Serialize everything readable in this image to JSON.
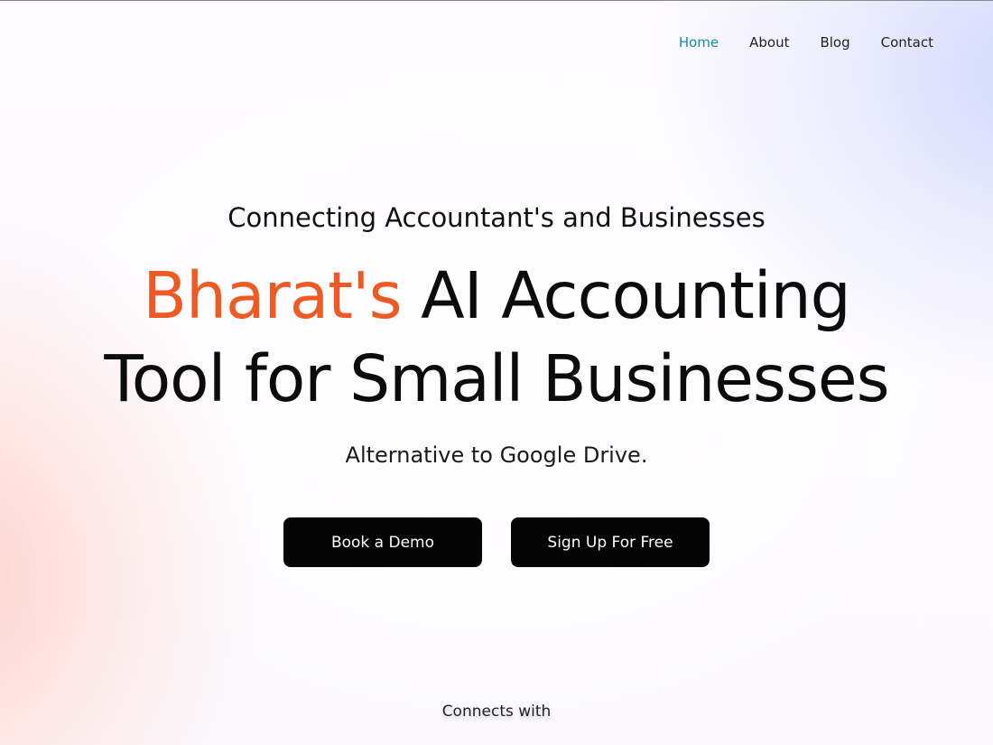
{
  "nav": {
    "items": [
      {
        "label": "Home",
        "active": true
      },
      {
        "label": "About",
        "active": false
      },
      {
        "label": "Blog",
        "active": false
      },
      {
        "label": "Contact",
        "active": false
      }
    ]
  },
  "hero": {
    "eyebrow": "Connecting Accountant's and Businesses",
    "headline_accent": "Bharat's",
    "headline_line1_rest": "AI Accounting",
    "headline_line2": "Tool for Small Businesses",
    "subtitle": "Alternative to Google Drive."
  },
  "cta": {
    "demo_label": "Book a Demo",
    "signup_label": "Sign Up For Free"
  },
  "integrations": {
    "heading": "Connects with"
  },
  "colors": {
    "accent": "#ef5a24",
    "nav_active": "#1b8aa3",
    "button_bg": "#050505",
    "button_text": "#ffffff"
  }
}
